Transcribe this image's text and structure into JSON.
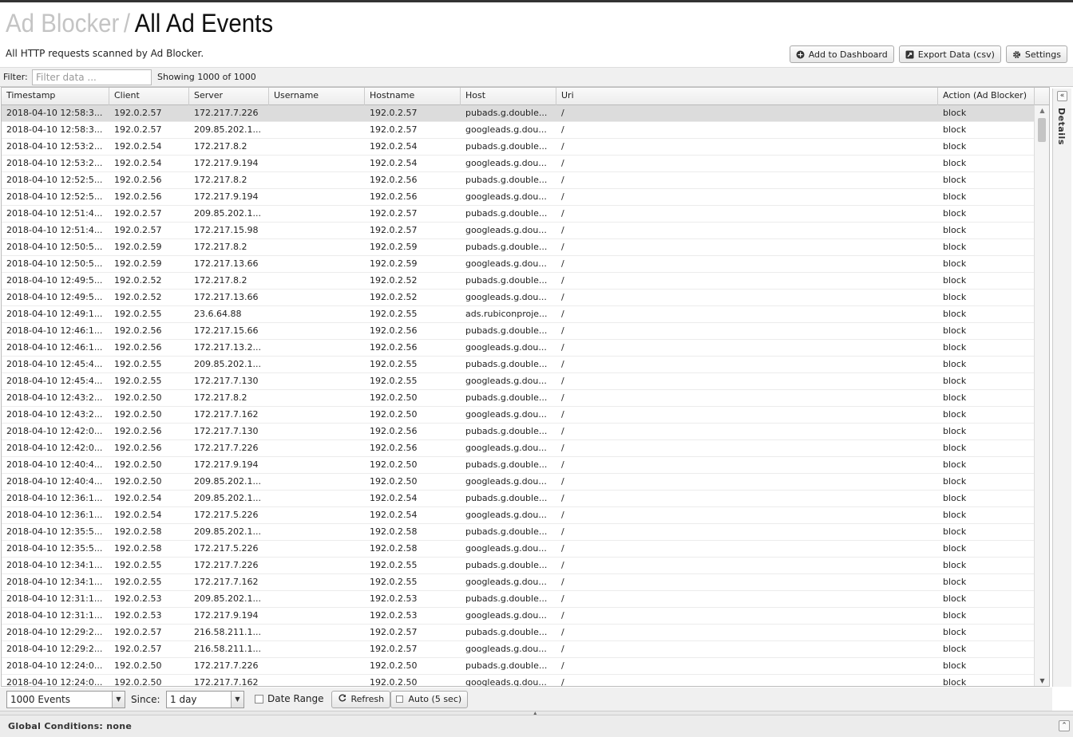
{
  "header": {
    "breadcrumb_parent": "Ad Blocker",
    "separator": "/",
    "title": "All Ad Events",
    "subtitle": "All HTTP requests scanned by Ad Blocker."
  },
  "actions": {
    "add_dashboard": "Add to Dashboard",
    "export": "Export Data (csv)",
    "settings": "Settings"
  },
  "filter": {
    "label": "Filter:",
    "placeholder": "Filter data ...",
    "count": "Showing 1000 of 1000"
  },
  "columns": [
    "Timestamp",
    "Client",
    "Server",
    "Username",
    "Hostname",
    "Host",
    "Uri",
    "Action (Ad Blocker)"
  ],
  "rows": [
    [
      "2018-04-10 12:58:3...",
      "192.0.2.57",
      "172.217.7.226",
      "",
      "192.0.2.57",
      "pubads.g.double...",
      "/",
      "block"
    ],
    [
      "2018-04-10 12:58:3...",
      "192.0.2.57",
      "209.85.202.1...",
      "",
      "192.0.2.57",
      "googleads.g.dou...",
      "/",
      "block"
    ],
    [
      "2018-04-10 12:53:2...",
      "192.0.2.54",
      "172.217.8.2",
      "",
      "192.0.2.54",
      "pubads.g.double...",
      "/",
      "block"
    ],
    [
      "2018-04-10 12:53:2...",
      "192.0.2.54",
      "172.217.9.194",
      "",
      "192.0.2.54",
      "googleads.g.dou...",
      "/",
      "block"
    ],
    [
      "2018-04-10 12:52:5...",
      "192.0.2.56",
      "172.217.8.2",
      "",
      "192.0.2.56",
      "pubads.g.double...",
      "/",
      "block"
    ],
    [
      "2018-04-10 12:52:5...",
      "192.0.2.56",
      "172.217.9.194",
      "",
      "192.0.2.56",
      "googleads.g.dou...",
      "/",
      "block"
    ],
    [
      "2018-04-10 12:51:4...",
      "192.0.2.57",
      "209.85.202.1...",
      "",
      "192.0.2.57",
      "pubads.g.double...",
      "/",
      "block"
    ],
    [
      "2018-04-10 12:51:4...",
      "192.0.2.57",
      "172.217.15.98",
      "",
      "192.0.2.57",
      "googleads.g.dou...",
      "/",
      "block"
    ],
    [
      "2018-04-10 12:50:5...",
      "192.0.2.59",
      "172.217.8.2",
      "",
      "192.0.2.59",
      "pubads.g.double...",
      "/",
      "block"
    ],
    [
      "2018-04-10 12:50:5...",
      "192.0.2.59",
      "172.217.13.66",
      "",
      "192.0.2.59",
      "googleads.g.dou...",
      "/",
      "block"
    ],
    [
      "2018-04-10 12:49:5...",
      "192.0.2.52",
      "172.217.8.2",
      "",
      "192.0.2.52",
      "pubads.g.double...",
      "/",
      "block"
    ],
    [
      "2018-04-10 12:49:5...",
      "192.0.2.52",
      "172.217.13.66",
      "",
      "192.0.2.52",
      "googleads.g.dou...",
      "/",
      "block"
    ],
    [
      "2018-04-10 12:49:1...",
      "192.0.2.55",
      "23.6.64.88",
      "",
      "192.0.2.55",
      "ads.rubiconproje...",
      "/",
      "block"
    ],
    [
      "2018-04-10 12:46:1...",
      "192.0.2.56",
      "172.217.15.66",
      "",
      "192.0.2.56",
      "pubads.g.double...",
      "/",
      "block"
    ],
    [
      "2018-04-10 12:46:1...",
      "192.0.2.56",
      "172.217.13.2...",
      "",
      "192.0.2.56",
      "googleads.g.dou...",
      "/",
      "block"
    ],
    [
      "2018-04-10 12:45:4...",
      "192.0.2.55",
      "209.85.202.1...",
      "",
      "192.0.2.55",
      "pubads.g.double...",
      "/",
      "block"
    ],
    [
      "2018-04-10 12:45:4...",
      "192.0.2.55",
      "172.217.7.130",
      "",
      "192.0.2.55",
      "googleads.g.dou...",
      "/",
      "block"
    ],
    [
      "2018-04-10 12:43:2...",
      "192.0.2.50",
      "172.217.8.2",
      "",
      "192.0.2.50",
      "pubads.g.double...",
      "/",
      "block"
    ],
    [
      "2018-04-10 12:43:2...",
      "192.0.2.50",
      "172.217.7.162",
      "",
      "192.0.2.50",
      "googleads.g.dou...",
      "/",
      "block"
    ],
    [
      "2018-04-10 12:42:0...",
      "192.0.2.56",
      "172.217.7.130",
      "",
      "192.0.2.56",
      "pubads.g.double...",
      "/",
      "block"
    ],
    [
      "2018-04-10 12:42:0...",
      "192.0.2.56",
      "172.217.7.226",
      "",
      "192.0.2.56",
      "googleads.g.dou...",
      "/",
      "block"
    ],
    [
      "2018-04-10 12:40:4...",
      "192.0.2.50",
      "172.217.9.194",
      "",
      "192.0.2.50",
      "pubads.g.double...",
      "/",
      "block"
    ],
    [
      "2018-04-10 12:40:4...",
      "192.0.2.50",
      "209.85.202.1...",
      "",
      "192.0.2.50",
      "googleads.g.dou...",
      "/",
      "block"
    ],
    [
      "2018-04-10 12:36:1...",
      "192.0.2.54",
      "209.85.202.1...",
      "",
      "192.0.2.54",
      "pubads.g.double...",
      "/",
      "block"
    ],
    [
      "2018-04-10 12:36:1...",
      "192.0.2.54",
      "172.217.5.226",
      "",
      "192.0.2.54",
      "googleads.g.dou...",
      "/",
      "block"
    ],
    [
      "2018-04-10 12:35:5...",
      "192.0.2.58",
      "209.85.202.1...",
      "",
      "192.0.2.58",
      "pubads.g.double...",
      "/",
      "block"
    ],
    [
      "2018-04-10 12:35:5...",
      "192.0.2.58",
      "172.217.5.226",
      "",
      "192.0.2.58",
      "googleads.g.dou...",
      "/",
      "block"
    ],
    [
      "2018-04-10 12:34:1...",
      "192.0.2.55",
      "172.217.7.226",
      "",
      "192.0.2.55",
      "pubads.g.double...",
      "/",
      "block"
    ],
    [
      "2018-04-10 12:34:1...",
      "192.0.2.55",
      "172.217.7.162",
      "",
      "192.0.2.55",
      "googleads.g.dou...",
      "/",
      "block"
    ],
    [
      "2018-04-10 12:31:1...",
      "192.0.2.53",
      "209.85.202.1...",
      "",
      "192.0.2.53",
      "pubads.g.double...",
      "/",
      "block"
    ],
    [
      "2018-04-10 12:31:1...",
      "192.0.2.53",
      "172.217.9.194",
      "",
      "192.0.2.53",
      "googleads.g.dou...",
      "/",
      "block"
    ],
    [
      "2018-04-10 12:29:2...",
      "192.0.2.57",
      "216.58.211.1...",
      "",
      "192.0.2.57",
      "pubads.g.double...",
      "/",
      "block"
    ],
    [
      "2018-04-10 12:29:2...",
      "192.0.2.57",
      "216.58.211.1...",
      "",
      "192.0.2.57",
      "googleads.g.dou...",
      "/",
      "block"
    ],
    [
      "2018-04-10 12:24:0...",
      "192.0.2.50",
      "172.217.7.226",
      "",
      "192.0.2.50",
      "pubads.g.double...",
      "/",
      "block"
    ],
    [
      "2018-04-10 12:24:0...",
      "192.0.2.50",
      "172.217.7.162",
      "",
      "192.0.2.50",
      "googleads.g.dou...",
      "/",
      "block"
    ]
  ],
  "details_panel": {
    "label": "Details"
  },
  "bottom": {
    "events_select": "1000 Events",
    "since_label": "Since:",
    "since_select": "1 day",
    "date_range_label": "Date Range",
    "refresh": "Refresh",
    "auto": "Auto (5 sec)"
  },
  "global_conditions": "Global Conditions: none",
  "icons": {
    "add": "plus-circle-icon",
    "export": "export-icon",
    "settings": "gear-icon",
    "refresh": "refresh-icon"
  }
}
